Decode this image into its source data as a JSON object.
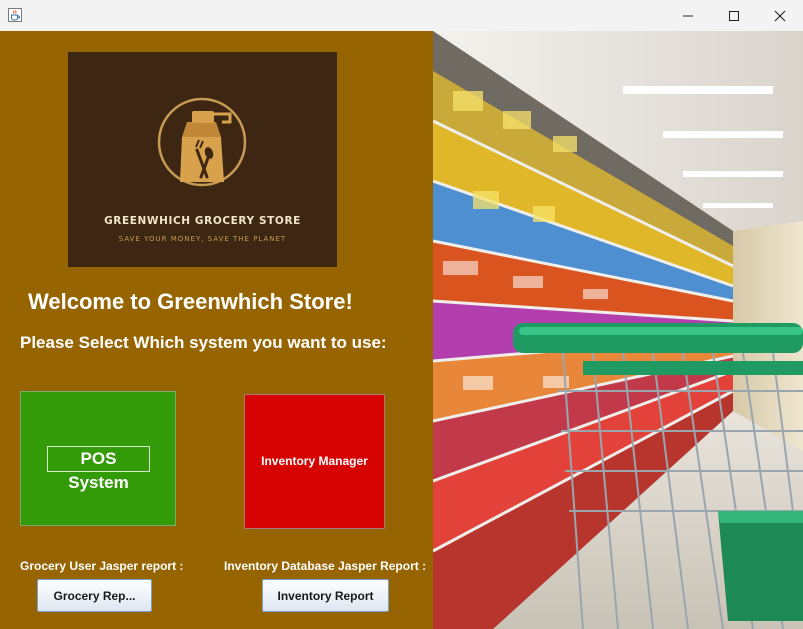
{
  "window": {
    "app_icon": "java-cup-icon",
    "controls": [
      "minimize-icon",
      "maximize-icon",
      "close-icon"
    ]
  },
  "logo": {
    "title": "GREENWHICH GROCERY STORE",
    "tagline": "SAVE YOUR MONEY, SAVE THE PLANET",
    "icon": "shopping-bag-with-utensils-icon"
  },
  "main": {
    "welcome": "Welcome to Greenwhich Store!",
    "prompt": "Please Select Which system you want to use:",
    "pos_button": "POS System",
    "inventory_button": "Inventory Manager"
  },
  "reports": {
    "grocery_caption": "Grocery User Jasper report :",
    "grocery_button": "Grocery Rep...",
    "inventory_caption": "Inventory Database Jasper Report :",
    "inventory_button": "Inventory Report"
  },
  "colors": {
    "panel_background": "#966400",
    "logo_background": "#3d2712",
    "pos_green": "#339b08",
    "inventory_red": "#d60303"
  }
}
